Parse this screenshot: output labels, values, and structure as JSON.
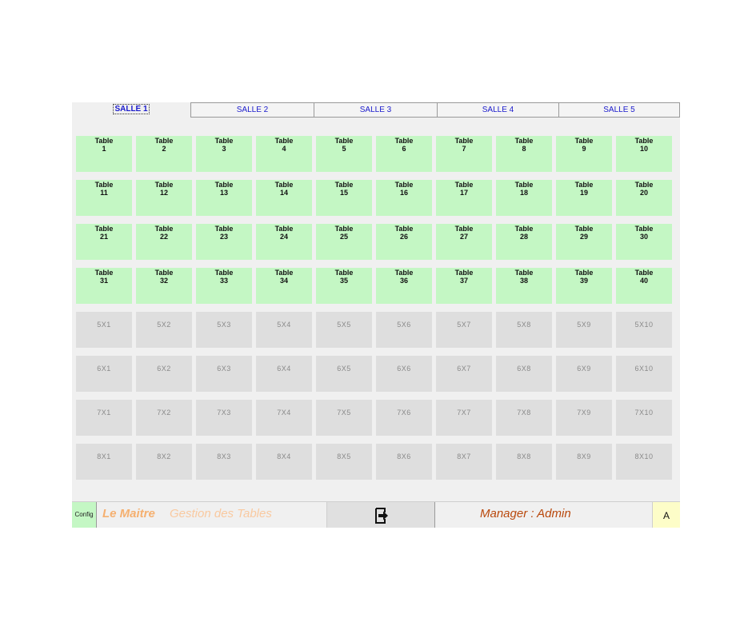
{
  "tabs": [
    {
      "label": "SALLE 1",
      "active": true
    },
    {
      "label": "SALLE 2",
      "active": false
    },
    {
      "label": "SALLE 3",
      "active": false
    },
    {
      "label": "SALLE 4",
      "active": false
    },
    {
      "label": "SALLE 5",
      "active": false
    }
  ],
  "grid": {
    "rows": [
      [
        {
          "kind": "table",
          "name": "Table",
          "number": "1"
        },
        {
          "kind": "table",
          "name": "Table",
          "number": "2"
        },
        {
          "kind": "table",
          "name": "Table",
          "number": "3"
        },
        {
          "kind": "table",
          "name": "Table",
          "number": "4"
        },
        {
          "kind": "table",
          "name": "Table",
          "number": "5"
        },
        {
          "kind": "table",
          "name": "Table",
          "number": "6"
        },
        {
          "kind": "table",
          "name": "Table",
          "number": "7"
        },
        {
          "kind": "table",
          "name": "Table",
          "number": "8"
        },
        {
          "kind": "table",
          "name": "Table",
          "number": "9"
        },
        {
          "kind": "table",
          "name": "Table",
          "number": "10"
        }
      ],
      [
        {
          "kind": "table",
          "name": "Table",
          "number": "11"
        },
        {
          "kind": "table",
          "name": "Table",
          "number": "12"
        },
        {
          "kind": "table",
          "name": "Table",
          "number": "13"
        },
        {
          "kind": "table",
          "name": "Table",
          "number": "14"
        },
        {
          "kind": "table",
          "name": "Table",
          "number": "15"
        },
        {
          "kind": "table",
          "name": "Table",
          "number": "16"
        },
        {
          "kind": "table",
          "name": "Table",
          "number": "17"
        },
        {
          "kind": "table",
          "name": "Table",
          "number": "18"
        },
        {
          "kind": "table",
          "name": "Table",
          "number": "19"
        },
        {
          "kind": "table",
          "name": "Table",
          "number": "20"
        }
      ],
      [
        {
          "kind": "table",
          "name": "Table",
          "number": "21"
        },
        {
          "kind": "table",
          "name": "Table",
          "number": "22"
        },
        {
          "kind": "table",
          "name": "Table",
          "number": "23"
        },
        {
          "kind": "table",
          "name": "Table",
          "number": "24"
        },
        {
          "kind": "table",
          "name": "Table",
          "number": "25"
        },
        {
          "kind": "table",
          "name": "Table",
          "number": "26"
        },
        {
          "kind": "table",
          "name": "Table",
          "number": "27"
        },
        {
          "kind": "table",
          "name": "Table",
          "number": "28"
        },
        {
          "kind": "table",
          "name": "Table",
          "number": "29"
        },
        {
          "kind": "table",
          "name": "Table",
          "number": "30"
        }
      ],
      [
        {
          "kind": "table",
          "name": "Table",
          "number": "31"
        },
        {
          "kind": "table",
          "name": "Table",
          "number": "32"
        },
        {
          "kind": "table",
          "name": "Table",
          "number": "33"
        },
        {
          "kind": "table",
          "name": "Table",
          "number": "34"
        },
        {
          "kind": "table",
          "name": "Table",
          "number": "35"
        },
        {
          "kind": "table",
          "name": "Table",
          "number": "36"
        },
        {
          "kind": "table",
          "name": "Table",
          "number": "37"
        },
        {
          "kind": "table",
          "name": "Table",
          "number": "38"
        },
        {
          "kind": "table",
          "name": "Table",
          "number": "39"
        },
        {
          "kind": "table",
          "name": "Table",
          "number": "40"
        }
      ],
      [
        {
          "kind": "empty",
          "label": "5X1"
        },
        {
          "kind": "empty",
          "label": "5X2"
        },
        {
          "kind": "empty",
          "label": "5X3"
        },
        {
          "kind": "empty",
          "label": "5X4"
        },
        {
          "kind": "empty",
          "label": "5X5"
        },
        {
          "kind": "empty",
          "label": "5X6"
        },
        {
          "kind": "empty",
          "label": "5X7"
        },
        {
          "kind": "empty",
          "label": "5X8"
        },
        {
          "kind": "empty",
          "label": "5X9"
        },
        {
          "kind": "empty",
          "label": "5X10"
        }
      ],
      [
        {
          "kind": "empty",
          "label": "6X1"
        },
        {
          "kind": "empty",
          "label": "6X2"
        },
        {
          "kind": "empty",
          "label": "6X3"
        },
        {
          "kind": "empty",
          "label": "6X4"
        },
        {
          "kind": "empty",
          "label": "6X5"
        },
        {
          "kind": "empty",
          "label": "6X6"
        },
        {
          "kind": "empty",
          "label": "6X7"
        },
        {
          "kind": "empty",
          "label": "6X8"
        },
        {
          "kind": "empty",
          "label": "6X9"
        },
        {
          "kind": "empty",
          "label": "6X10"
        }
      ],
      [
        {
          "kind": "empty",
          "label": "7X1"
        },
        {
          "kind": "empty",
          "label": "7X2"
        },
        {
          "kind": "empty",
          "label": "7X3"
        },
        {
          "kind": "empty",
          "label": "7X4"
        },
        {
          "kind": "empty",
          "label": "7X5"
        },
        {
          "kind": "empty",
          "label": "7X6"
        },
        {
          "kind": "empty",
          "label": "7X7"
        },
        {
          "kind": "empty",
          "label": "7X8"
        },
        {
          "kind": "empty",
          "label": "7X9"
        },
        {
          "kind": "empty",
          "label": "7X10"
        }
      ],
      [
        {
          "kind": "empty",
          "label": "8X1"
        },
        {
          "kind": "empty",
          "label": "8X2"
        },
        {
          "kind": "empty",
          "label": "8X3"
        },
        {
          "kind": "empty",
          "label": "8X4"
        },
        {
          "kind": "empty",
          "label": "8X5"
        },
        {
          "kind": "empty",
          "label": "8X6"
        },
        {
          "kind": "empty",
          "label": "8X7"
        },
        {
          "kind": "empty",
          "label": "8X8"
        },
        {
          "kind": "empty",
          "label": "8X9"
        },
        {
          "kind": "empty",
          "label": "8X10"
        }
      ]
    ]
  },
  "bottombar": {
    "config_label": "Config",
    "app_name": "Le Maitre",
    "app_subtitle": "Gestion des Tables",
    "exit_icon": "exit-icon",
    "manager_text": "Manager : Admin",
    "user_button_label": "A"
  },
  "colors": {
    "table_bg": "#c4f7c4",
    "empty_bg": "#dedede",
    "tab_text": "#1a1acc",
    "app_name": "#f5b070",
    "manager_text": "#b9480c",
    "user_button_bg": "#fdfdc8"
  }
}
